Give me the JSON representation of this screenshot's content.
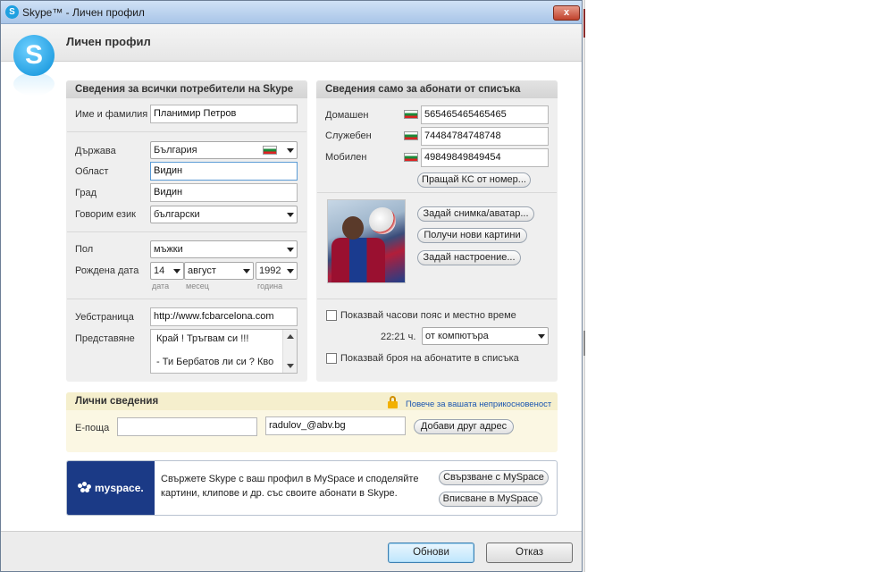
{
  "window": {
    "title": "Skype™ - Личен профил",
    "close_glyph": "x"
  },
  "header": {
    "title": "Личен профил",
    "logo_letter": "S"
  },
  "public_panel": {
    "heading": "Сведения за всички потребители на Skype",
    "full_name_label": "Име и фамилия",
    "full_name_value": "Планимир Петров",
    "country_label": "Държава",
    "country_value": "България",
    "region_label": "Област",
    "region_value": "Видин",
    "city_label": "Град",
    "city_value": "Видин",
    "language_label": "Говорим език",
    "language_value": "български",
    "gender_label": "Пол",
    "gender_value": "мъжки",
    "birthdate_label": "Рождена дата",
    "birth_day": "14",
    "birth_month": "август",
    "birth_year": "1992",
    "day_caption": "дата",
    "month_caption": "месец",
    "year_caption": "година",
    "homepage_label": "Уебстраница",
    "homepage_value": "http://www.fcbarcelona.com",
    "about_label": "Представяне",
    "about_line1": "Край ! Тръгвам си !!!",
    "about_line2": "- Ти Бербатов ли си ? Кво"
  },
  "contacts_panel": {
    "heading": "Сведения само за абонати от списъка",
    "home_label": "Домашен",
    "home_value": "565465465465465",
    "office_label": "Служебен",
    "office_value": "74484784748748",
    "mobile_label": "Мобилен",
    "mobile_value": "49849849849454",
    "sms_button": "Пращай КС от номер...",
    "avatar_button": "Задай снимка/аватар...",
    "new_pictures_button": "Получи нови картини",
    "mood_button": "Задай настроение...",
    "timezone_checkbox": "Показвай часови пояс и местно време",
    "time_value": "22:21 ч.",
    "time_source": "от компютъра",
    "contacts_checkbox": "Показвай броя на абонатите в списъка"
  },
  "personal": {
    "heading": "Лични сведения",
    "privacy_link": "Повече за вашата неприкосновеност",
    "email_label": "Е-поща",
    "email_value_1": "",
    "email_value_2": "radulov_@abv.bg",
    "add_email_button": "Добави друг адрес"
  },
  "myspace": {
    "logo_text": "myspace.",
    "description": "Свържете Skype с ваш профил в MySpace и споделяйте картини, клипове и др. със своите абонати в Skype.",
    "connect_button": "Свързване с MySpace",
    "signup_button": "Вписване в MySpace"
  },
  "footer": {
    "update_button": "Обнови",
    "cancel_button": "Отказ"
  },
  "colors": {
    "accent": "#1fa0e0",
    "myspace_blue": "#1b3a86",
    "link": "#1a55b0"
  }
}
